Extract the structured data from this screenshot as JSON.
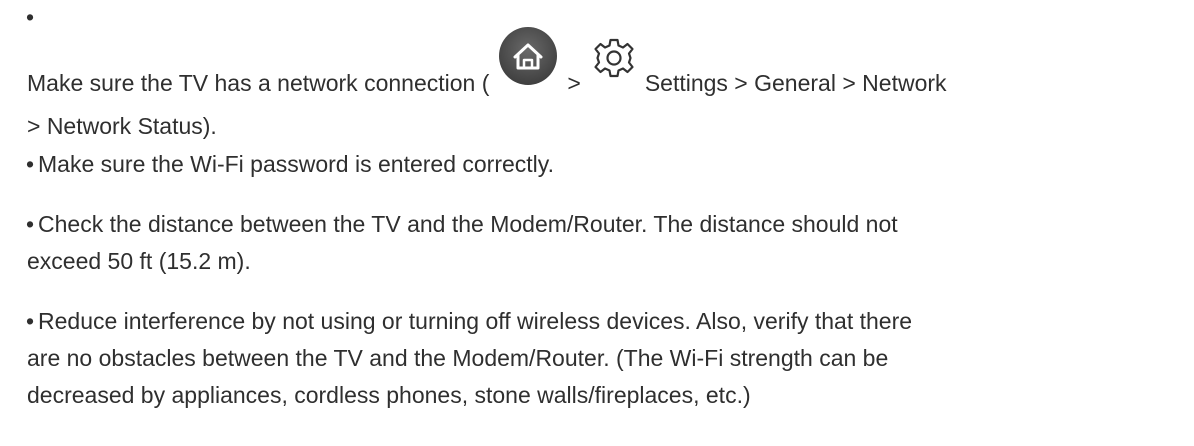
{
  "tips": {
    "bullet": "•",
    "item1": {
      "part_a": "Make sure the TV has a network connection (",
      "icon_home": "home-icon",
      "sep": ">",
      "icon_gear": "gear-icon",
      "part_b": "Settings > General > Network",
      "part_c": "> Network Status)."
    },
    "item2": "Make sure the Wi-Fi password is entered correctly.",
    "item3": {
      "line1": "Check the distance between the TV and the Modem/Router. The distance should not",
      "line2": "exceed 50 ft (15.2 m)."
    },
    "item4": {
      "line1": "Reduce interference by not using or turning off wireless devices. Also, verify that there",
      "line2": "are no obstacles between the TV and the Modem/Router. (The Wi-Fi strength can be",
      "line3": "decreased by appliances, cordless phones, stone walls/fireplaces, etc.)"
    }
  },
  "colors": {
    "text": "#2f2f2f",
    "home_icon_bg": "#555555",
    "home_icon_fg": "#ffffff",
    "gear_stroke": "#333333"
  }
}
